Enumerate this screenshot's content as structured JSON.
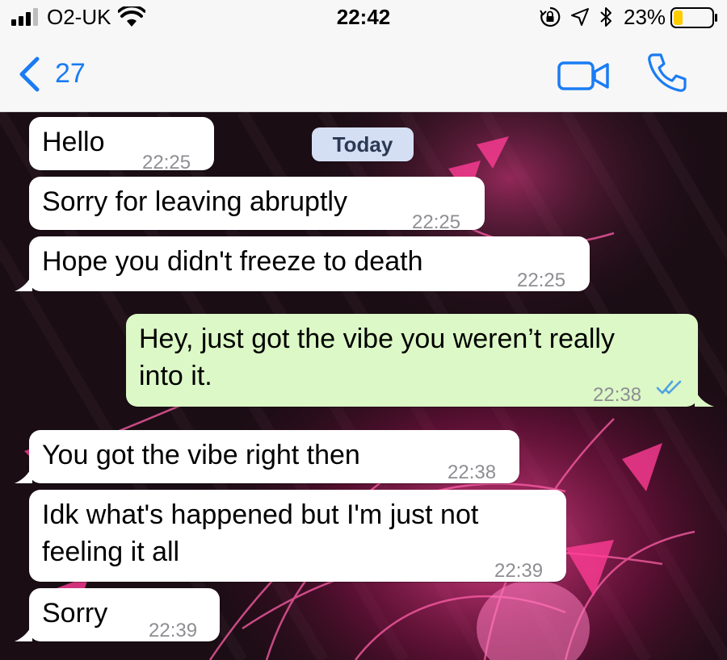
{
  "status_bar": {
    "carrier": "O2-UK",
    "time": "22:42",
    "battery_percent": "23%",
    "battery_level": 0.23,
    "battery_color": "#ffcc00",
    "icons": [
      "signal-icon",
      "wifi-icon",
      "orientation-lock-icon",
      "location-icon",
      "bluetooth-icon",
      "battery-icon"
    ]
  },
  "nav_bar": {
    "back_count": "27",
    "accent_color": "#1a7cf3",
    "icons": [
      "back-chevron-icon",
      "video-camera-icon",
      "phone-icon"
    ]
  },
  "chat": {
    "date_label": "Today",
    "messages": [
      {
        "direction": "incoming",
        "text": "Hello",
        "time": "22:25"
      },
      {
        "direction": "incoming",
        "text": "Sorry for leaving abruptly",
        "time": "22:25"
      },
      {
        "direction": "incoming",
        "text": "Hope you didn't freeze to death",
        "time": "22:25"
      },
      {
        "direction": "outgoing",
        "text_lines": [
          "Hey, just got the vibe you weren’t really",
          "into it."
        ],
        "time": "22:38",
        "status": "read"
      },
      {
        "direction": "incoming",
        "text": "You got the vibe right then",
        "time": "22:38"
      },
      {
        "direction": "incoming",
        "text_lines": [
          "Idk what's happened but I'm just not",
          "feeling it all"
        ],
        "time": "22:39"
      },
      {
        "direction": "incoming",
        "text": "Sorry",
        "time": "22:39"
      }
    ],
    "colors": {
      "incoming_bubble": "#ffffff",
      "outgoing_bubble": "#dcf8c6",
      "read_ticks": "#4fa3e0"
    }
  }
}
